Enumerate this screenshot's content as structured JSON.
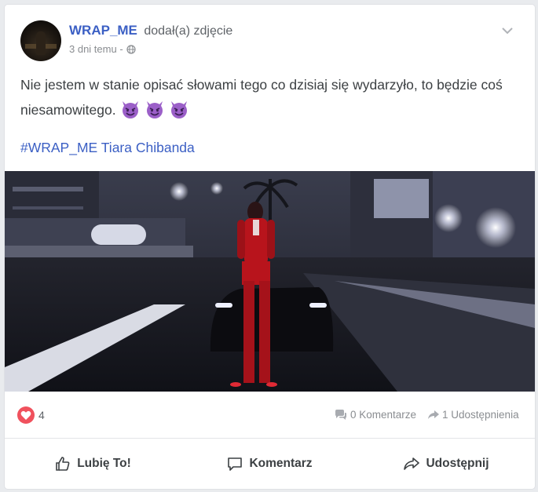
{
  "post": {
    "author": "WRAP_ME",
    "action_text": "dodał(a) zdjęcie",
    "time": "3 dni temu -",
    "body": "Nie jestem w stanie opisać słowami tego co dzisiaj się wydarzyło, to będzie coś niesamowitego.",
    "hashtags": "#WRAP_ME Tiara Chibanda",
    "emoji_icon": "smiling-imp-icon",
    "emoji_count": 3
  },
  "stats": {
    "reaction_icon": "heart-icon",
    "reaction_count": "4",
    "comments": "0 Komentarze",
    "shares": "1 Udostępnienia"
  },
  "actions": {
    "like": "Lubię To!",
    "comment": "Komentarz",
    "share": "Udostępnij"
  },
  "colors": {
    "accent": "#3b5fc4",
    "heart": "#f0515d",
    "emoji": "#9b5fc8"
  }
}
